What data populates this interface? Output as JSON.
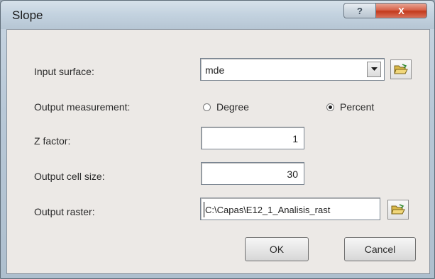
{
  "window": {
    "title": "Slope",
    "help_label": "?",
    "close_label": "X"
  },
  "form": {
    "input_surface": {
      "label": "Input surface:",
      "value": "mde"
    },
    "output_measurement": {
      "label": "Output measurement:",
      "options": [
        "Degree",
        "Percent"
      ],
      "selected": "Percent"
    },
    "z_factor": {
      "label": "Z factor:",
      "value": "1"
    },
    "output_cell_size": {
      "label": "Output cell size:",
      "value": "30"
    },
    "output_raster": {
      "label": "Output raster:",
      "value": "C:\\Capas\\E12_1_Analisis_rast"
    }
  },
  "buttons": {
    "ok": "OK",
    "cancel": "Cancel"
  },
  "icons": {
    "folder": "open-folder-icon",
    "dropdown": "dropdown-arrow-icon"
  }
}
